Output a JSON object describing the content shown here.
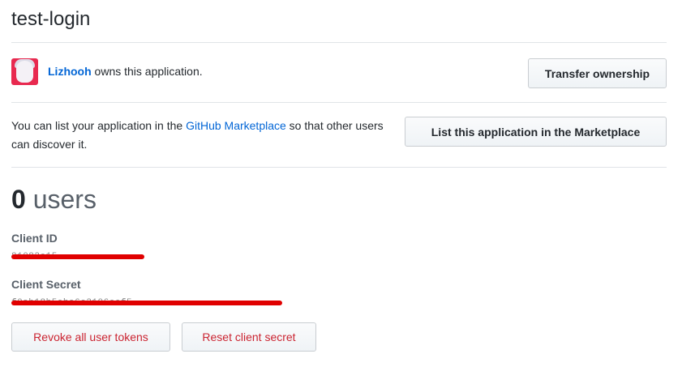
{
  "app": {
    "title": "test-login"
  },
  "owner": {
    "username": "Lizhooh",
    "text": " owns this application.",
    "transfer_label": "Transfer ownership"
  },
  "marketplace": {
    "text_before": "You can list your application in the ",
    "link_text": "GitHub Marketplace",
    "text_after": " so that other users can discover it.",
    "button_label": "List this application in the Marketplace"
  },
  "users": {
    "count": "0",
    "label": "users"
  },
  "client_id": {
    "label": "Client ID",
    "value_visible": "81082e15"
  },
  "client_secret": {
    "label": "Client Secret",
    "value_visible": "f0ab18b5eba6e3106eef5"
  },
  "actions": {
    "revoke_label": "Revoke all user tokens",
    "reset_label": "Reset client secret"
  },
  "colors": {
    "link": "#0366d6",
    "danger": "#cb2431",
    "redaction": "#e00000"
  }
}
